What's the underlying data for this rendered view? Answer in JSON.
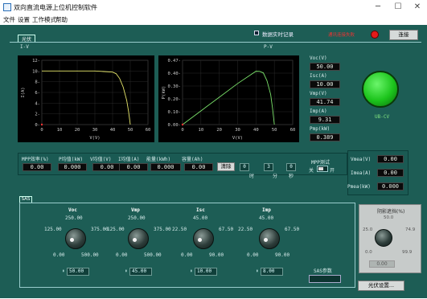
{
  "window": {
    "title": "双向直流电源上位机控制软件",
    "minimize": "─",
    "maximize": "☐",
    "close": "✕"
  },
  "menu": [
    "文件",
    "设置",
    "工作模式",
    "帮助"
  ],
  "tab_main": "光伏",
  "record_checkbox_label": "数据实时记录",
  "status_text": "通讯连接失败",
  "connect_button": "连接",
  "chart_iv": {
    "label": "I-V",
    "title": "",
    "xlabel": "V(V)",
    "ylabel": "I(A)",
    "xticks": [
      "0",
      "10",
      "20",
      "30",
      "40",
      "50",
      "60"
    ],
    "yticks": [
      "0-",
      "2-",
      "4-",
      "6-",
      "8-",
      "10-",
      "12-"
    ]
  },
  "chart_pv": {
    "label": "P-V",
    "title": "",
    "xlabel": "V(V)",
    "ylabel": "P(kW)",
    "xticks": [
      "0",
      "10",
      "20",
      "30",
      "40",
      "50",
      "60"
    ],
    "yticks": [
      "0.00-",
      "0.10-",
      "0.20-",
      "0.30-",
      "0.40-",
      "0.47-"
    ]
  },
  "chart_data": [
    {
      "type": "line",
      "title": "",
      "xlabel": "V(V)",
      "ylabel": "I(A)",
      "xlim": [
        0,
        60
      ],
      "ylim": [
        0,
        12
      ],
      "series": [
        {
          "x": [
            0,
            10,
            20,
            30,
            40,
            42,
            44,
            46,
            48,
            49,
            50
          ],
          "y": [
            10,
            10,
            10,
            10,
            9.8,
            9.5,
            8.6,
            7.0,
            4.5,
            2.5,
            0
          ]
        }
      ]
    },
    {
      "type": "line",
      "title": "",
      "xlabel": "V(V)",
      "ylabel": "P(kW)",
      "xlim": [
        0,
        60
      ],
      "ylim": [
        0,
        0.47
      ],
      "series": [
        {
          "x": [
            0,
            10,
            20,
            30,
            40,
            42,
            44,
            46,
            48,
            49,
            50
          ],
          "y": [
            0,
            0.1,
            0.2,
            0.3,
            0.39,
            0.389,
            0.378,
            0.32,
            0.22,
            0.12,
            0
          ]
        }
      ]
    }
  ],
  "side_readouts": [
    {
      "label": "Voc(V)",
      "value": "50.00"
    },
    {
      "label": "Isc(A)",
      "value": "10.00"
    },
    {
      "label": "Vmp(V)",
      "value": "41.74"
    },
    {
      "label": "Imp(A)",
      "value": "9.31"
    },
    {
      "label": "Pmp(kW)",
      "value": "0.389"
    }
  ],
  "indicator_label": "UB-CV",
  "stats": [
    {
      "label": "MPP效率(%)",
      "value": "0.00"
    },
    {
      "label": "P均值(kW)",
      "value": "0.000"
    },
    {
      "label": "V均值(V)",
      "value": "0.00"
    },
    {
      "label": "I均值(A)",
      "value": "0.00"
    },
    {
      "label": "能量(kWh)",
      "value": "0.000"
    },
    {
      "label": "容量(Ah)",
      "value": "0.00"
    }
  ],
  "clear_button": "清除",
  "timer": {
    "h": "0",
    "m": "3",
    "s": "0",
    "h_label": "时",
    "m_label": "分",
    "s_label": "秒"
  },
  "mpp_test": {
    "label": "MPP测试",
    "off": "关",
    "on": "开"
  },
  "meas": [
    {
      "label": "Vmea(V)",
      "value": "0.00"
    },
    {
      "label": "Imea(A)",
      "value": "0.00"
    },
    {
      "label": "Pmea(kW)",
      "value": "0.000"
    }
  ],
  "sas_tab": "SAS",
  "knobs": [
    {
      "name": "Voc",
      "top": "250.00",
      "left": "125.00",
      "right": "375.00",
      "bl": "0.00",
      "br": "500.00",
      "value": "50.00"
    },
    {
      "name": "Vmp",
      "top": "250.00",
      "left": "125.00",
      "right": "375.00",
      "bl": "0.00",
      "br": "500.00",
      "value": "45.00"
    },
    {
      "name": "Isc",
      "top": "45.00",
      "left": "22.50",
      "right": "67.50",
      "bl": "0.00",
      "br": "90.00",
      "value": "10.00"
    },
    {
      "name": "Imp",
      "top": "45.00",
      "left": "22.50",
      "right": "67.50",
      "bl": "0.00",
      "br": "90.00",
      "value": "8.00"
    }
  ],
  "sas_param_label": "SAS参数",
  "shadow": {
    "label": "阴影遮挡(%)",
    "top": "50.0",
    "left": "25.0",
    "right": "74.9",
    "bl": "0.0",
    "br": "99.9",
    "value": "0.00"
  },
  "pv_settings_button": "光伏设置..."
}
